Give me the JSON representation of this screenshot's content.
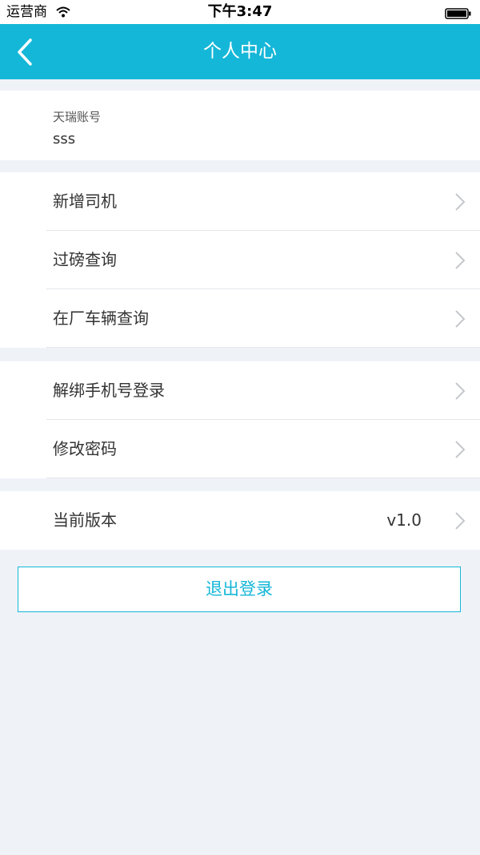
{
  "status_bar": {
    "carrier": "运营商",
    "time": "下午3:47"
  },
  "nav": {
    "title": "个人中心"
  },
  "account": {
    "label": "天瑞账号",
    "value": "sss"
  },
  "menu_group1": [
    {
      "label": "新增司机"
    },
    {
      "label": "过磅查询"
    },
    {
      "label": "在厂车辆查询"
    }
  ],
  "menu_group2": [
    {
      "label": "解绑手机号登录"
    },
    {
      "label": "修改密码"
    }
  ],
  "version": {
    "label": "当前版本",
    "value": "v1.0"
  },
  "logout_label": "退出登录",
  "colors": {
    "accent": "#15b7d8",
    "background": "#eff3f8",
    "divider": "#e3e6ea"
  }
}
